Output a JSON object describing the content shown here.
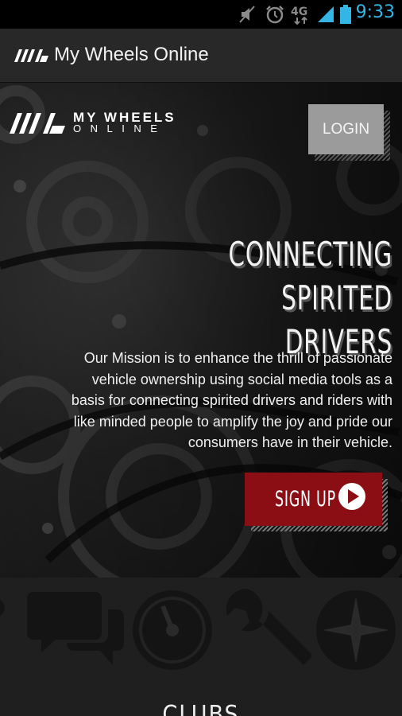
{
  "status_bar": {
    "time": "9:33",
    "network": "4G",
    "icons": [
      "mute-icon",
      "alarm-icon",
      "network-4g-icon",
      "signal-icon",
      "battery-icon"
    ]
  },
  "action_bar": {
    "title": "My Wheels Online",
    "logo_icon": "app-logo-icon"
  },
  "hero": {
    "brand_line1": "MY WHEELS",
    "brand_line2": "ONLINE",
    "login_label": "LOGIN",
    "headline_line1": "CONNECTING SPIRITED",
    "headline_line2": "DRIVERS",
    "mission": "Our Mission is to enhance the thrill of passionate vehicle ownership using social media tools as a basis for connecting spirited drivers and riders with like minded people to amplify the joy and pride our consumers have in their vehicle.",
    "signup_label": "SIGN UP",
    "signup_icon": "play-circle-icon"
  },
  "features": {
    "icons": [
      "chat-bubbles-icon",
      "speedometer-icon",
      "wrench-icon",
      "compass-icon"
    ],
    "section_heading": "CLUBS"
  },
  "colors": {
    "accent_red": "#8b0e14",
    "status_blue": "#33b5e5",
    "login_gray": "#9b9b9b"
  }
}
